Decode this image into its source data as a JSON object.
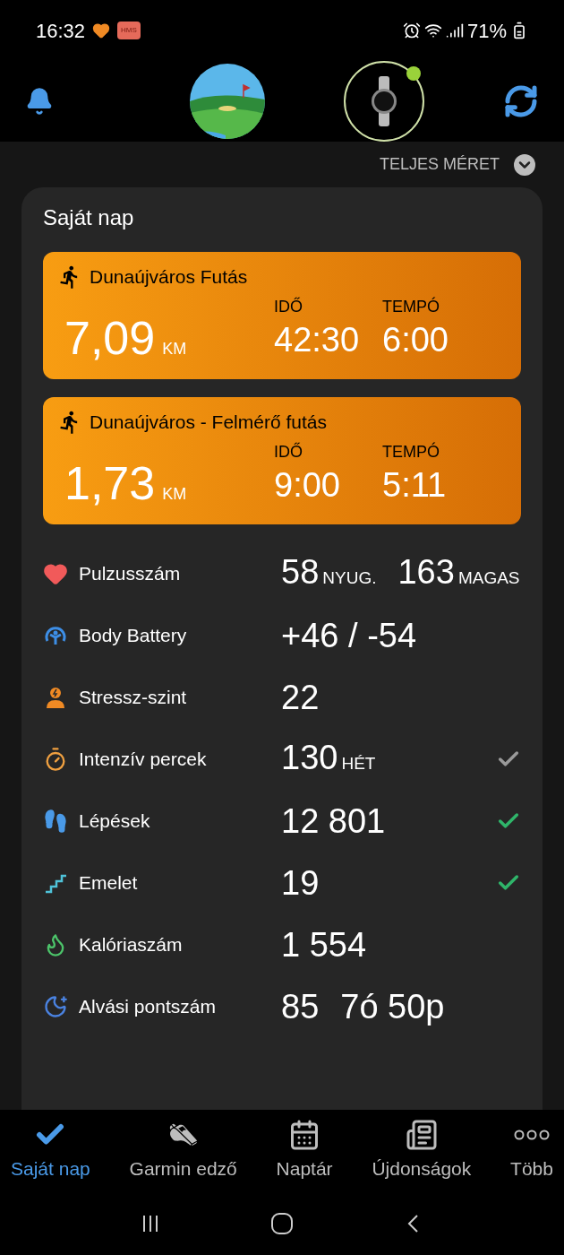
{
  "status_bar": {
    "time": "16:32",
    "app_badge": "HMS",
    "battery": "71%"
  },
  "view_toggle": {
    "label": "TELJES MÉRET"
  },
  "day_card": {
    "title": "Saját nap",
    "activities": [
      {
        "title": "Dunaújváros Futás",
        "distance": "7,09",
        "unit": "KM",
        "stats": [
          {
            "label": "IDŐ",
            "value": "42:30"
          },
          {
            "label": "TEMPÓ",
            "value": "6:00"
          }
        ]
      },
      {
        "title": "Dunaújváros - Felmérő futás",
        "distance": "1,73",
        "unit": "KM",
        "stats": [
          {
            "label": "IDŐ",
            "value": "9:00"
          },
          {
            "label": "TEMPÓ",
            "value": "5:11"
          }
        ]
      }
    ],
    "metrics": [
      {
        "kind": "heart",
        "label": "Pulzusszám",
        "values": [
          {
            "value": "58",
            "unit": "NYUG."
          },
          {
            "value": "163",
            "unit": "MAGAS"
          }
        ]
      },
      {
        "kind": "battery",
        "label": "Body Battery",
        "values": [
          {
            "value": "+46 / -54"
          }
        ]
      },
      {
        "kind": "stress",
        "label": "Stressz-szint",
        "values": [
          {
            "value": "22"
          }
        ]
      },
      {
        "kind": "intensity",
        "label": "Intenzív percek",
        "values": [
          {
            "value": "130",
            "unit": "HÉT"
          }
        ],
        "goal_met": false
      },
      {
        "kind": "steps",
        "label": "Lépések",
        "values": [
          {
            "value": "12 801"
          }
        ],
        "goal_met": true
      },
      {
        "kind": "floors",
        "label": "Emelet",
        "values": [
          {
            "value": "19"
          }
        ],
        "goal_met": true
      },
      {
        "kind": "calories",
        "label": "Kalóriaszám",
        "values": [
          {
            "value": "1 554"
          }
        ]
      },
      {
        "kind": "sleep",
        "label": "Alvási pontszám",
        "values": [
          {
            "value": "85"
          },
          {
            "value": "7ó 50p"
          }
        ]
      }
    ]
  },
  "bottom_nav": [
    {
      "kind": "day",
      "label": "Saját nap",
      "selected": true
    },
    {
      "kind": "coach",
      "label": "Garmin edző",
      "selected": false
    },
    {
      "kind": "calendar",
      "label": "Naptár",
      "selected": false
    },
    {
      "kind": "news",
      "label": "Újdonságok",
      "selected": false
    },
    {
      "kind": "more",
      "label": "Több",
      "selected": false
    }
  ]
}
